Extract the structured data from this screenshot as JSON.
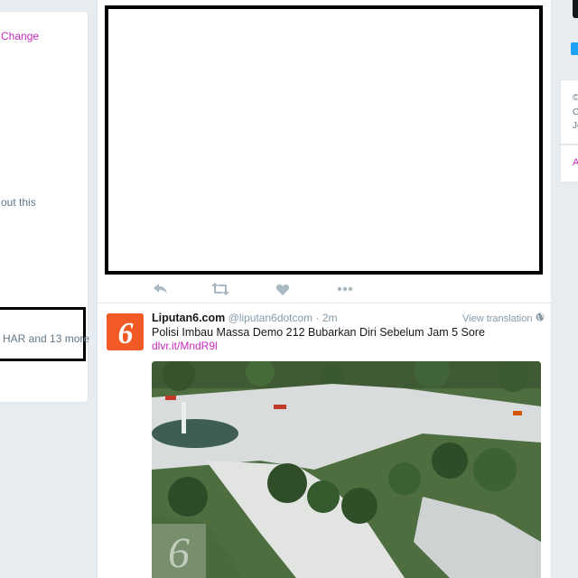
{
  "left_panel": {
    "change_label": "Change",
    "about_text": "out this",
    "followers_text": "HAR and 13 more"
  },
  "tweet": {
    "name": "Liputan6.com",
    "handle": "@liputan6dotcom",
    "separator": "·",
    "time": "2m",
    "view_translation": "View translation",
    "text": "Polisi Imbau Massa Demo 212 Bubarkan Diri Sebelum Jam 5 Sore",
    "link": "dlvr.it/MndR9l",
    "avatar_glyph": "6",
    "watermark_glyph": "6"
  },
  "actions": [
    {
      "name": "reply-icon"
    },
    {
      "name": "retweet-icon"
    },
    {
      "name": "like-icon"
    },
    {
      "name": "more-icon"
    }
  ],
  "right_panel": {
    "lines": [
      "©",
      "C",
      "Je"
    ],
    "link_letter": "A"
  },
  "colors": {
    "accent": "#c62bbd",
    "avatar_bg": "#f15a24",
    "muted": "#8899a6"
  }
}
